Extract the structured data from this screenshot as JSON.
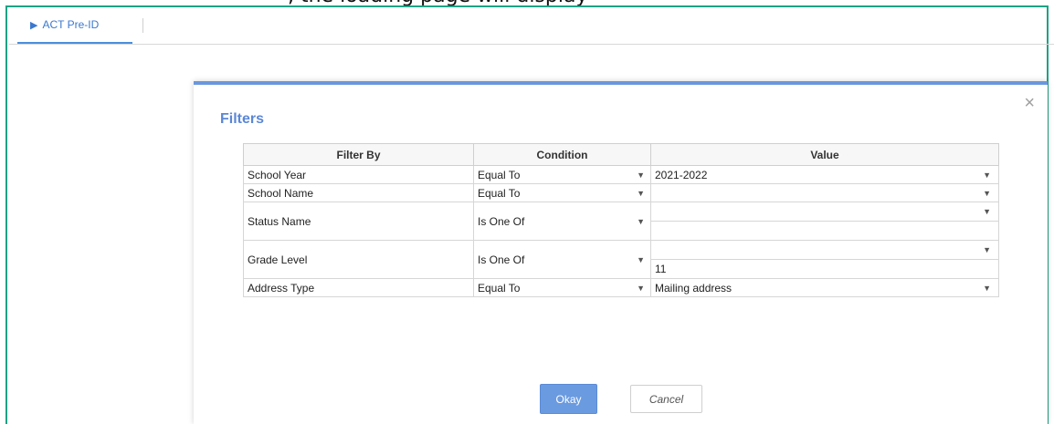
{
  "top_partial_text": ", the loading page will display",
  "tabs": [
    {
      "label": "ACT Pre-ID"
    }
  ],
  "modal": {
    "title": "Filters",
    "close_glyph": "×",
    "columns": [
      "Filter By",
      "Condition",
      "Value"
    ],
    "rows": [
      {
        "filter": "School Year",
        "condition": "Equal To",
        "value": "2021-2022"
      },
      {
        "filter": "School Name",
        "condition": "Equal To",
        "value": ""
      },
      {
        "filter": "Status Name",
        "condition": "Is One Of",
        "value": ""
      },
      {
        "filter": "Grade Level",
        "condition": "Is One Of",
        "value": "11"
      },
      {
        "filter": "Address Type",
        "condition": "Equal To",
        "value": "Mailing address"
      }
    ],
    "okay_label": "Okay",
    "cancel_label": "Cancel"
  },
  "icons": {
    "tab": "play-icon",
    "caret": "caret-down-icon",
    "close": "close-icon"
  },
  "colors": {
    "accent": "#5b87d6",
    "frame": "#1ea285",
    "button": "#6a9ae0"
  }
}
